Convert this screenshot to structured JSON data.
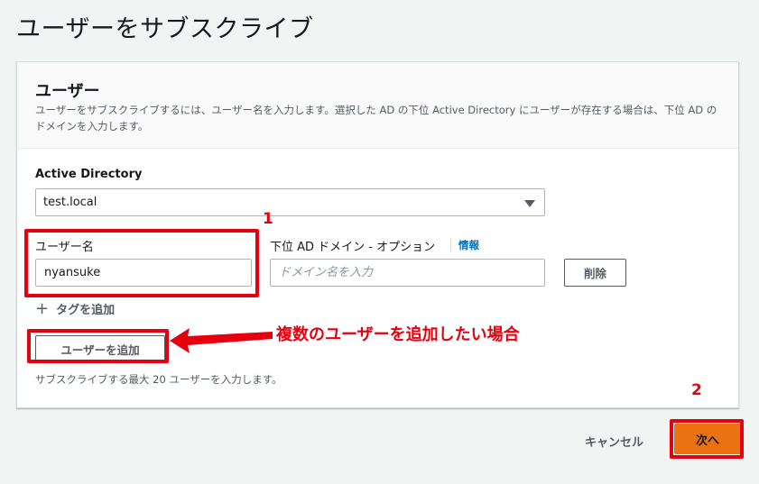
{
  "page": {
    "title": "ユーザーをサブスクライブ"
  },
  "panel": {
    "title": "ユーザー",
    "description": "ユーザーをサブスクライブするには、ユーザー名を入力します。選択した AD の下位 Active Directory にユーザーが存在する場合は、下位 AD のドメインを入力します。"
  },
  "form": {
    "directory_label": "Active Directory",
    "directory_value": "test.local",
    "username_label": "ユーザー名",
    "username_value": "nyansuke",
    "subdomain_label": "下位 AD ドメイン - オプション",
    "info_link": "情報",
    "subdomain_placeholder": "ドメイン名を入力",
    "delete_button": "削除",
    "add_tag": "タグを追加",
    "add_user_button": "ユーザーを追加",
    "hint": "サブスクライブする最大 20 ユーザーを入力します。"
  },
  "footer": {
    "cancel": "キャンセル",
    "next": "次へ"
  },
  "annotations": {
    "step1": "1",
    "step2": "2",
    "callout": "複数のユーザーを追加したい場合"
  },
  "colors": {
    "accent": "#ec7211",
    "annotation": "#e5000f",
    "link": "#0073bb"
  },
  "icons": {
    "dropdown": "caret-down-icon",
    "add_tag": "plus-icon",
    "callout": "arrow-left-icon"
  }
}
